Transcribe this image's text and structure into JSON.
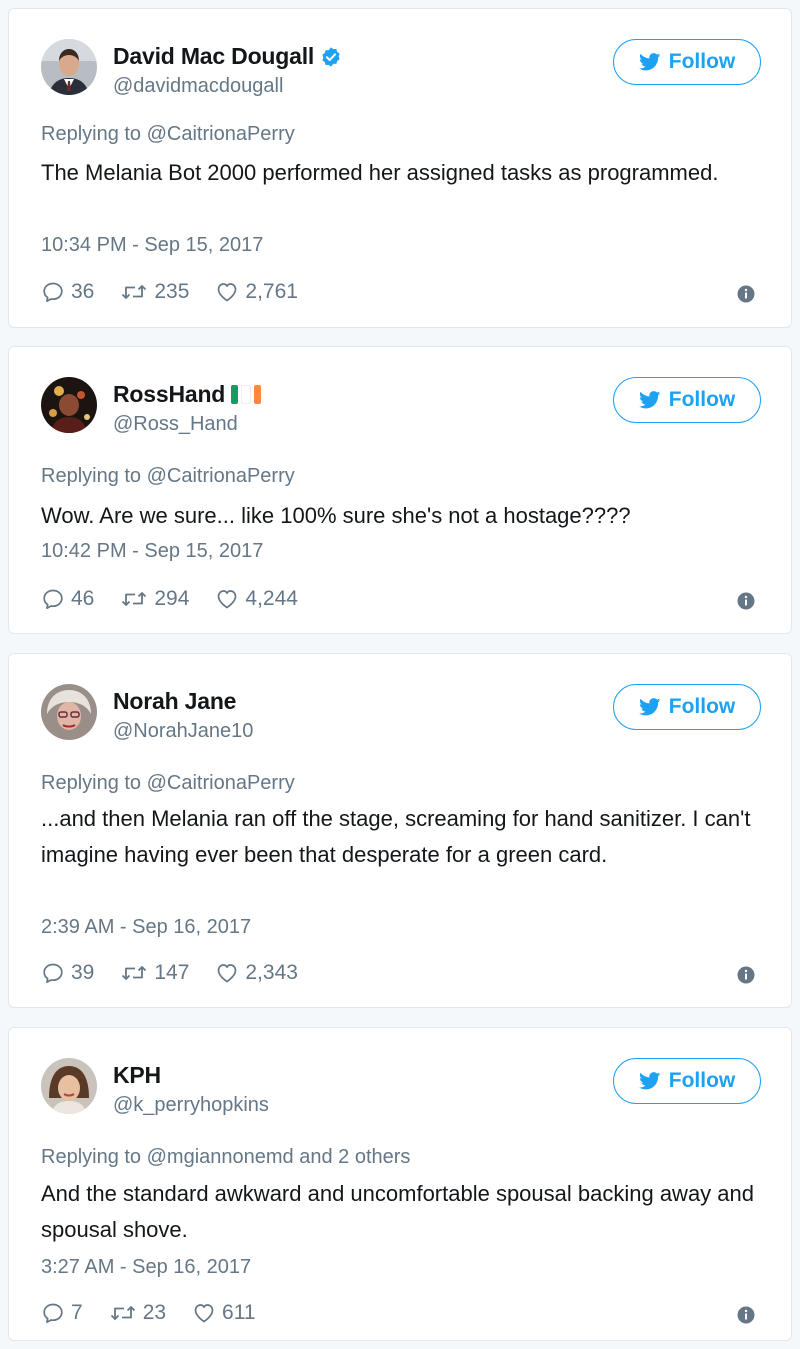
{
  "follow_label": "Follow",
  "colors": {
    "accent": "#1da1f2",
    "secondary_text": "#657786",
    "verified": "#1da1f2"
  },
  "tweets": [
    {
      "name": "David Mac Dougall",
      "handle": "@davidmacdougall",
      "verified": true,
      "reply_to": "Replying to @CaitrionaPerry",
      "text": "The Melania Bot 2000 performed her assigned tasks as programmed.",
      "time": "10:34 PM - Sep 15, 2017",
      "replies": "36",
      "retweets": "235",
      "likes": "2,761"
    },
    {
      "name": "RossHand",
      "handle": "@Ross_Hand",
      "flag": "ireland-flag-icon",
      "reply_to": "Replying to @CaitrionaPerry",
      "text": "Wow. Are we sure... like 100% sure she's not a hostage????",
      "time": "10:42 PM - Sep 15, 2017",
      "replies": "46",
      "retweets": "294",
      "likes": "4,244"
    },
    {
      "name": "Norah Jane",
      "handle": "@NorahJane10",
      "reply_to": "Replying to @CaitrionaPerry",
      "text": "...and then Melania ran off the stage, screaming for hand sanitizer. I can't imagine having ever been that desperate for a green card.",
      "time": "2:39 AM - Sep 16, 2017",
      "replies": "39",
      "retweets": "147",
      "likes": "2,343"
    },
    {
      "name": "KPH",
      "handle": "@k_perryhopkins",
      "reply_to": "Replying to @mgiannonemd and 2 others",
      "text": "And the standard awkward and uncomfortable spousal backing away and spousal shove.",
      "time": "3:27 AM - Sep 16, 2017",
      "replies": "7",
      "retweets": "23",
      "likes": "611"
    }
  ]
}
